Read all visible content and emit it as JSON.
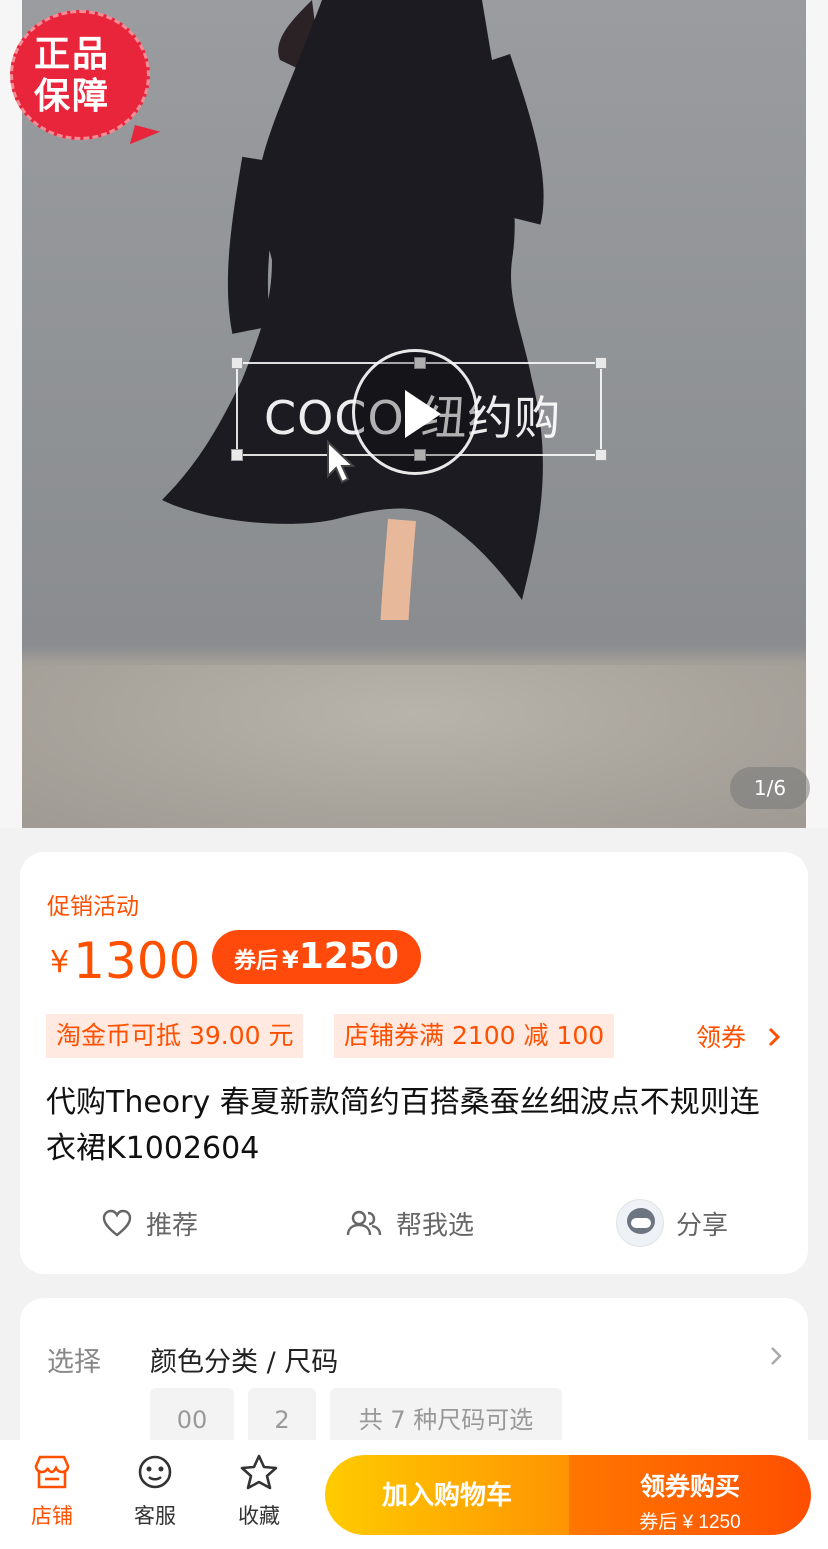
{
  "hero": {
    "badge": "正品\n保障",
    "watermark": "COCO 纽约购",
    "counter": "1/6"
  },
  "price": {
    "promo_label": "促销活动",
    "currency": "¥",
    "value": "1300",
    "coupon_prefix": "券后",
    "coupon_currency": "¥",
    "coupon_value": "1250"
  },
  "tags": [
    "淘金币可抵 39.00 元",
    "店铺券满 2100 减 100"
  ],
  "get_coupon": "领券",
  "title": "代购Theory 春夏新款简约百搭桑蚕丝细波点不规则连衣裙K1002604",
  "actions": {
    "recommend": "推荐",
    "help_choose": "帮我选",
    "share": "分享"
  },
  "select": {
    "label": "选择",
    "value": "颜色分类 / 尺码",
    "options": [
      "00",
      "2",
      "共 7 种尺码可选"
    ]
  },
  "bottom": {
    "store": "店铺",
    "service": "客服",
    "favorite": "收藏",
    "add_to_cart": "加入购物车",
    "buy_main": "领券购买",
    "buy_sub": "券后 ¥ 1250"
  },
  "colors": {
    "accent": "#ff5000",
    "badge_red": "#e8253a"
  },
  "icons": [
    "store-icon",
    "service-icon",
    "star-icon",
    "heart-icon",
    "people-icon",
    "chevron-right-icon",
    "play-icon",
    "cursor-icon"
  ]
}
